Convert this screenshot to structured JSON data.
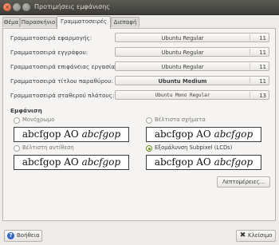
{
  "window": {
    "title": "Προτιμήσεις εμφάνισης",
    "close_glyph": "×",
    "min_glyph": "",
    "max_glyph": ""
  },
  "tabs": [
    {
      "label": "Θέμα",
      "active": false
    },
    {
      "label": "Παρασκήνιο",
      "active": false
    },
    {
      "label": "Γραμματοσειρές",
      "active": true
    },
    {
      "label": "Διεπαφή",
      "active": false
    }
  ],
  "fonts": [
    {
      "label": "Γραμματοσειρά εφαρμογής:",
      "family": "Ubuntu Regular",
      "size": "11"
    },
    {
      "label": "Γραμματοσειρά εγγράφου:",
      "family": "Ubuntu Regular",
      "size": "11"
    },
    {
      "label": "Γραμματοσειρά επιφάνειας εργασίας:",
      "family": "Ubuntu Regular",
      "size": "11"
    },
    {
      "label": "Γραμματοσειρά τίτλου παραθύρου:",
      "family": "Ubuntu Medium",
      "size": "11"
    },
    {
      "label": "Γραμματοσειρά σταθερού πλάτους:",
      "family": "Ubuntu Mono Regular",
      "size": "13"
    }
  ],
  "appearance": {
    "heading": "Εμφάνιση",
    "preview_plain": "abcfgop AO ",
    "preview_italic": "abcfgop",
    "options": [
      {
        "label": "Μονόχρωμο",
        "checked": false
      },
      {
        "label": "Βέλτιστα σχήματα",
        "checked": false
      },
      {
        "label": "Βέλτιστη αντίθεση",
        "checked": false
      },
      {
        "label": "Εξομάλυνση Subpixel (LCDs)",
        "checked": true
      }
    ],
    "details_label": "Λεπτομέρειες..."
  },
  "footer": {
    "help_label": "Βοήθεια",
    "help_icon": "help-icon",
    "close_label": "Κλείσιμο",
    "close_icon": "close-icon",
    "close_glyph": "✖",
    "help_glyph": "?"
  }
}
